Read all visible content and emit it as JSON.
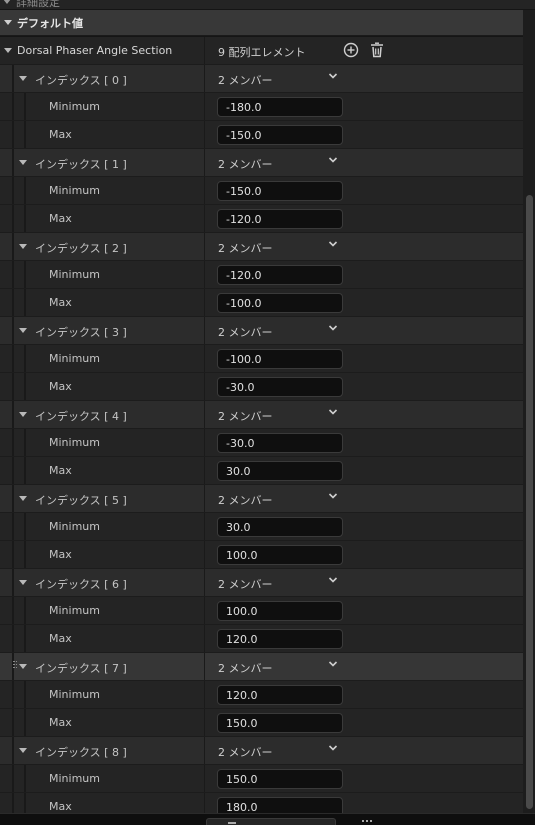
{
  "top_cut_label": "詳細設定",
  "category_label": "デフォルト値",
  "property": {
    "name": "Dorsal Phaser Angle Section",
    "summary": "9 配列エレメント"
  },
  "icons": {
    "add": "plus-circle-icon",
    "delete": "trash-icon",
    "expand": "chevron-down-icon",
    "collapse": "triangle-down-icon"
  },
  "elements": [
    {
      "label": "インデックス [ 0 ]",
      "members": "2 メンバー",
      "min_label": "Minimum",
      "max_label": "Max",
      "min": "-180.0",
      "max": "-150.0"
    },
    {
      "label": "インデックス [ 1 ]",
      "members": "2 メンバー",
      "min_label": "Minimum",
      "max_label": "Max",
      "min": "-150.0",
      "max": "-120.0"
    },
    {
      "label": "インデックス [ 2 ]",
      "members": "2 メンバー",
      "min_label": "Minimum",
      "max_label": "Max",
      "min": "-120.0",
      "max": "-100.0"
    },
    {
      "label": "インデックス [ 3 ]",
      "members": "2 メンバー",
      "min_label": "Minimum",
      "max_label": "Max",
      "min": "-100.0",
      "max": "-30.0"
    },
    {
      "label": "インデックス [ 4 ]",
      "members": "2 メンバー",
      "min_label": "Minimum",
      "max_label": "Max",
      "min": "-30.0",
      "max": "30.0"
    },
    {
      "label": "インデックス [ 5 ]",
      "members": "2 メンバー",
      "min_label": "Minimum",
      "max_label": "Max",
      "min": "30.0",
      "max": "100.0"
    },
    {
      "label": "インデックス [ 6 ]",
      "members": "2 メンバー",
      "min_label": "Minimum",
      "max_label": "Max",
      "min": "100.0",
      "max": "120.0"
    },
    {
      "label": "インデックス [ 7 ]",
      "members": "2 メンバー",
      "min_label": "Minimum",
      "max_label": "Max",
      "min": "120.0",
      "max": "150.0"
    },
    {
      "label": "インデックス [ 8 ]",
      "members": "2 メンバー",
      "min_label": "Minimum",
      "max_label": "Max",
      "min": "150.0",
      "max": "180.0"
    }
  ]
}
